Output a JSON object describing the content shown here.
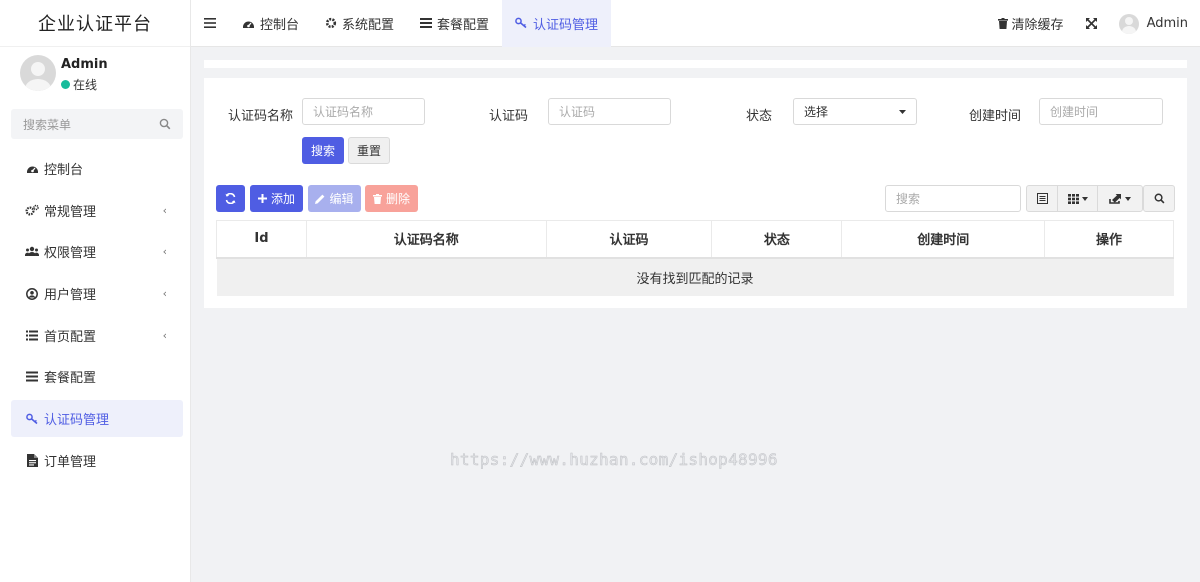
{
  "app": {
    "brand": "企业认证平台"
  },
  "user": {
    "name": "Admin",
    "status": "在线"
  },
  "sidebar": {
    "search_placeholder": "搜索菜单",
    "items": [
      {
        "label": "控制台",
        "icon": "dashboard-icon",
        "has_arrow": false,
        "active": false
      },
      {
        "label": "常规管理",
        "icon": "cogs-icon",
        "has_arrow": true,
        "active": false
      },
      {
        "label": "权限管理",
        "icon": "group-icon",
        "has_arrow": true,
        "active": false
      },
      {
        "label": "用户管理",
        "icon": "user-circle-icon",
        "has_arrow": true,
        "active": false
      },
      {
        "label": "首页配置",
        "icon": "list-icon",
        "has_arrow": true,
        "active": false
      },
      {
        "label": "套餐配置",
        "icon": "bars-icon",
        "has_arrow": false,
        "active": false
      },
      {
        "label": "认证码管理",
        "icon": "key-icon",
        "has_arrow": false,
        "active": true
      },
      {
        "label": "订单管理",
        "icon": "file-text-icon",
        "has_arrow": false,
        "active": false
      }
    ],
    "arrow_glyph": "‹"
  },
  "topnav": {
    "tabs": [
      {
        "label": "控制台",
        "icon": "dashboard-icon",
        "active": false
      },
      {
        "label": "系统配置",
        "icon": "gear-icon",
        "active": false
      },
      {
        "label": "套餐配置",
        "icon": "bars-icon",
        "active": false
      },
      {
        "label": "认证码管理",
        "icon": "key-icon",
        "active": true
      }
    ],
    "clear_cache": "清除缓存",
    "admin": "Admin"
  },
  "filters": {
    "name_label": "认证码名称",
    "name_placeholder": "认证码名称",
    "code_label": "认证码",
    "code_placeholder": "认证码",
    "status_label": "状态",
    "status_value": "选择",
    "created_label": "创建时间",
    "created_placeholder": "创建时间",
    "search_button": "搜索",
    "reset_button": "重置"
  },
  "toolbar": {
    "add": "添加",
    "edit": "编辑",
    "delete": "删除",
    "search_placeholder": "搜索"
  },
  "table": {
    "columns": [
      "Id",
      "认证码名称",
      "认证码",
      "状态",
      "创建时间",
      "操作"
    ],
    "empty_text": "没有找到匹配的记录"
  },
  "watermark": "https://www.huzhan.com/ishop48996",
  "colors": {
    "primary": "#4f5de3",
    "online": "#18bc9c",
    "danger_light": "#f8a29a",
    "primary_light": "#a8b0ee"
  }
}
